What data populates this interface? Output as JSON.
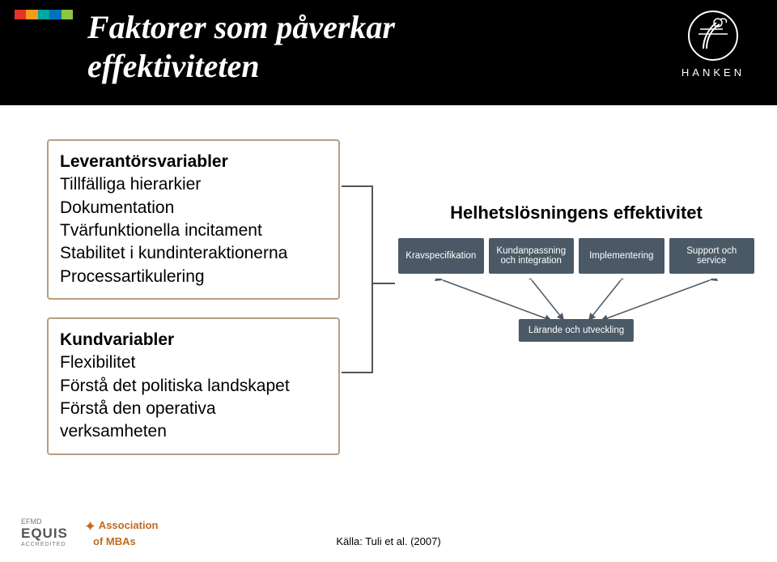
{
  "header": {
    "title_line1": "Faktorer som påverkar",
    "title_line2": "effektiviteten",
    "brand": "HANKEN"
  },
  "leftBoxes": {
    "box1": {
      "heading": "Leverantörsvariabler",
      "lines": [
        "Tillfälliga hierarkier",
        "Dokumentation",
        "Tvärfunktionella incitament",
        "Stabilitet i kundinteraktionerna",
        "Processartikulering"
      ]
    },
    "box2": {
      "heading": "Kundvariabler",
      "lines": [
        "Flexibilitet",
        "Förstå det politiska landskapet",
        "Förstå den operativa verksamheten"
      ]
    }
  },
  "right": {
    "title": "Helhetslösningens effektivitet",
    "stages": [
      "Kravspecifikation",
      "Kundanpassning och integration",
      "Implementering",
      "Support och service"
    ],
    "learning": "Lärande och utveckling"
  },
  "footer": {
    "efmd": "EFMD",
    "equis": "EQUIS",
    "accredited": "ACCREDITED",
    "amba1": "Association",
    "amba2": "of MBAs",
    "source": "Källa: Tuli et al. (2007)"
  }
}
